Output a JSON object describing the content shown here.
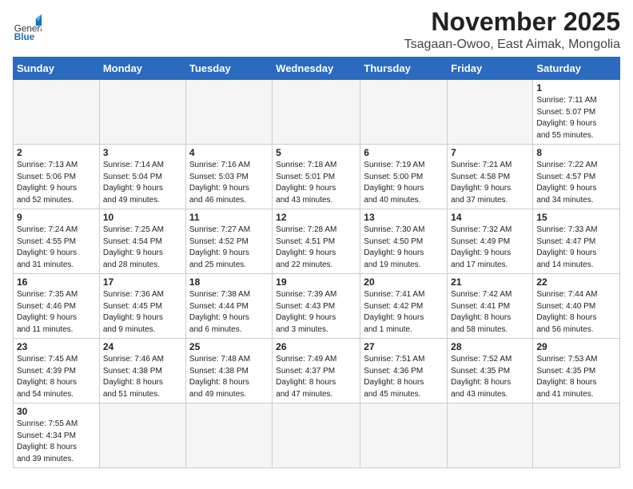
{
  "header": {
    "logo_general": "General",
    "logo_blue": "Blue",
    "month": "November 2025",
    "location": "Tsagaan-Owoo, East Aimak, Mongolia"
  },
  "days_of_week": [
    "Sunday",
    "Monday",
    "Tuesday",
    "Wednesday",
    "Thursday",
    "Friday",
    "Saturday"
  ],
  "weeks": [
    [
      {
        "day": "",
        "info": ""
      },
      {
        "day": "",
        "info": ""
      },
      {
        "day": "",
        "info": ""
      },
      {
        "day": "",
        "info": ""
      },
      {
        "day": "",
        "info": ""
      },
      {
        "day": "",
        "info": ""
      },
      {
        "day": "1",
        "info": "Sunrise: 7:11 AM\nSunset: 5:07 PM\nDaylight: 9 hours\nand 55 minutes."
      }
    ],
    [
      {
        "day": "2",
        "info": "Sunrise: 7:13 AM\nSunset: 5:06 PM\nDaylight: 9 hours\nand 52 minutes."
      },
      {
        "day": "3",
        "info": "Sunrise: 7:14 AM\nSunset: 5:04 PM\nDaylight: 9 hours\nand 49 minutes."
      },
      {
        "day": "4",
        "info": "Sunrise: 7:16 AM\nSunset: 5:03 PM\nDaylight: 9 hours\nand 46 minutes."
      },
      {
        "day": "5",
        "info": "Sunrise: 7:18 AM\nSunset: 5:01 PM\nDaylight: 9 hours\nand 43 minutes."
      },
      {
        "day": "6",
        "info": "Sunrise: 7:19 AM\nSunset: 5:00 PM\nDaylight: 9 hours\nand 40 minutes."
      },
      {
        "day": "7",
        "info": "Sunrise: 7:21 AM\nSunset: 4:58 PM\nDaylight: 9 hours\nand 37 minutes."
      },
      {
        "day": "8",
        "info": "Sunrise: 7:22 AM\nSunset: 4:57 PM\nDaylight: 9 hours\nand 34 minutes."
      }
    ],
    [
      {
        "day": "9",
        "info": "Sunrise: 7:24 AM\nSunset: 4:55 PM\nDaylight: 9 hours\nand 31 minutes."
      },
      {
        "day": "10",
        "info": "Sunrise: 7:25 AM\nSunset: 4:54 PM\nDaylight: 9 hours\nand 28 minutes."
      },
      {
        "day": "11",
        "info": "Sunrise: 7:27 AM\nSunset: 4:52 PM\nDaylight: 9 hours\nand 25 minutes."
      },
      {
        "day": "12",
        "info": "Sunrise: 7:28 AM\nSunset: 4:51 PM\nDaylight: 9 hours\nand 22 minutes."
      },
      {
        "day": "13",
        "info": "Sunrise: 7:30 AM\nSunset: 4:50 PM\nDaylight: 9 hours\nand 19 minutes."
      },
      {
        "day": "14",
        "info": "Sunrise: 7:32 AM\nSunset: 4:49 PM\nDaylight: 9 hours\nand 17 minutes."
      },
      {
        "day": "15",
        "info": "Sunrise: 7:33 AM\nSunset: 4:47 PM\nDaylight: 9 hours\nand 14 minutes."
      }
    ],
    [
      {
        "day": "16",
        "info": "Sunrise: 7:35 AM\nSunset: 4:46 PM\nDaylight: 9 hours\nand 11 minutes."
      },
      {
        "day": "17",
        "info": "Sunrise: 7:36 AM\nSunset: 4:45 PM\nDaylight: 9 hours\nand 9 minutes."
      },
      {
        "day": "18",
        "info": "Sunrise: 7:38 AM\nSunset: 4:44 PM\nDaylight: 9 hours\nand 6 minutes."
      },
      {
        "day": "19",
        "info": "Sunrise: 7:39 AM\nSunset: 4:43 PM\nDaylight: 9 hours\nand 3 minutes."
      },
      {
        "day": "20",
        "info": "Sunrise: 7:41 AM\nSunset: 4:42 PM\nDaylight: 9 hours\nand 1 minute."
      },
      {
        "day": "21",
        "info": "Sunrise: 7:42 AM\nSunset: 4:41 PM\nDaylight: 8 hours\nand 58 minutes."
      },
      {
        "day": "22",
        "info": "Sunrise: 7:44 AM\nSunset: 4:40 PM\nDaylight: 8 hours\nand 56 minutes."
      }
    ],
    [
      {
        "day": "23",
        "info": "Sunrise: 7:45 AM\nSunset: 4:39 PM\nDaylight: 8 hours\nand 54 minutes."
      },
      {
        "day": "24",
        "info": "Sunrise: 7:46 AM\nSunset: 4:38 PM\nDaylight: 8 hours\nand 51 minutes."
      },
      {
        "day": "25",
        "info": "Sunrise: 7:48 AM\nSunset: 4:38 PM\nDaylight: 8 hours\nand 49 minutes."
      },
      {
        "day": "26",
        "info": "Sunrise: 7:49 AM\nSunset: 4:37 PM\nDaylight: 8 hours\nand 47 minutes."
      },
      {
        "day": "27",
        "info": "Sunrise: 7:51 AM\nSunset: 4:36 PM\nDaylight: 8 hours\nand 45 minutes."
      },
      {
        "day": "28",
        "info": "Sunrise: 7:52 AM\nSunset: 4:35 PM\nDaylight: 8 hours\nand 43 minutes."
      },
      {
        "day": "29",
        "info": "Sunrise: 7:53 AM\nSunset: 4:35 PM\nDaylight: 8 hours\nand 41 minutes."
      }
    ],
    [
      {
        "day": "30",
        "info": "Sunrise: 7:55 AM\nSunset: 4:34 PM\nDaylight: 8 hours\nand 39 minutes."
      },
      {
        "day": "",
        "info": ""
      },
      {
        "day": "",
        "info": ""
      },
      {
        "day": "",
        "info": ""
      },
      {
        "day": "",
        "info": ""
      },
      {
        "day": "",
        "info": ""
      },
      {
        "day": "",
        "info": ""
      }
    ]
  ]
}
